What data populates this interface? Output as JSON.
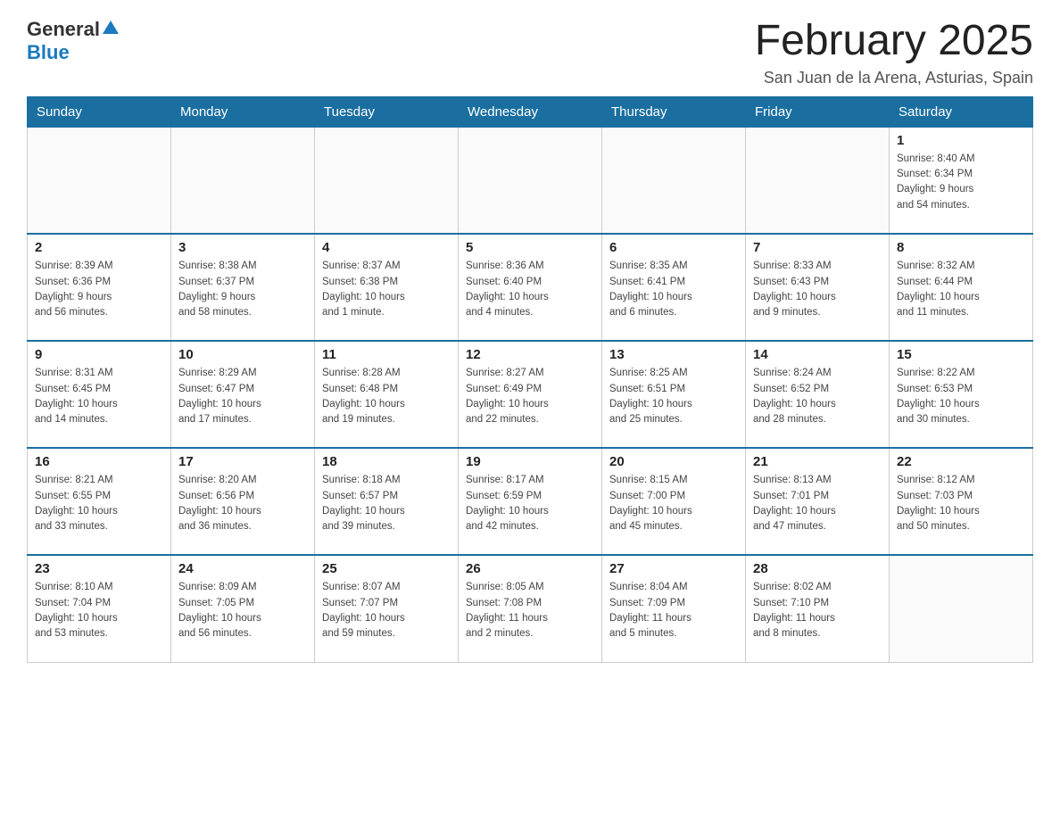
{
  "header": {
    "logo": {
      "general": "General",
      "blue": "Blue"
    },
    "title": "February 2025",
    "subtitle": "San Juan de la Arena, Asturias, Spain"
  },
  "days_of_week": [
    "Sunday",
    "Monday",
    "Tuesday",
    "Wednesday",
    "Thursday",
    "Friday",
    "Saturday"
  ],
  "weeks": [
    {
      "days": [
        {
          "num": "",
          "info": ""
        },
        {
          "num": "",
          "info": ""
        },
        {
          "num": "",
          "info": ""
        },
        {
          "num": "",
          "info": ""
        },
        {
          "num": "",
          "info": ""
        },
        {
          "num": "",
          "info": ""
        },
        {
          "num": "1",
          "info": "Sunrise: 8:40 AM\nSunset: 6:34 PM\nDaylight: 9 hours\nand 54 minutes."
        }
      ]
    },
    {
      "days": [
        {
          "num": "2",
          "info": "Sunrise: 8:39 AM\nSunset: 6:36 PM\nDaylight: 9 hours\nand 56 minutes."
        },
        {
          "num": "3",
          "info": "Sunrise: 8:38 AM\nSunset: 6:37 PM\nDaylight: 9 hours\nand 58 minutes."
        },
        {
          "num": "4",
          "info": "Sunrise: 8:37 AM\nSunset: 6:38 PM\nDaylight: 10 hours\nand 1 minute."
        },
        {
          "num": "5",
          "info": "Sunrise: 8:36 AM\nSunset: 6:40 PM\nDaylight: 10 hours\nand 4 minutes."
        },
        {
          "num": "6",
          "info": "Sunrise: 8:35 AM\nSunset: 6:41 PM\nDaylight: 10 hours\nand 6 minutes."
        },
        {
          "num": "7",
          "info": "Sunrise: 8:33 AM\nSunset: 6:43 PM\nDaylight: 10 hours\nand 9 minutes."
        },
        {
          "num": "8",
          "info": "Sunrise: 8:32 AM\nSunset: 6:44 PM\nDaylight: 10 hours\nand 11 minutes."
        }
      ]
    },
    {
      "days": [
        {
          "num": "9",
          "info": "Sunrise: 8:31 AM\nSunset: 6:45 PM\nDaylight: 10 hours\nand 14 minutes."
        },
        {
          "num": "10",
          "info": "Sunrise: 8:29 AM\nSunset: 6:47 PM\nDaylight: 10 hours\nand 17 minutes."
        },
        {
          "num": "11",
          "info": "Sunrise: 8:28 AM\nSunset: 6:48 PM\nDaylight: 10 hours\nand 19 minutes."
        },
        {
          "num": "12",
          "info": "Sunrise: 8:27 AM\nSunset: 6:49 PM\nDaylight: 10 hours\nand 22 minutes."
        },
        {
          "num": "13",
          "info": "Sunrise: 8:25 AM\nSunset: 6:51 PM\nDaylight: 10 hours\nand 25 minutes."
        },
        {
          "num": "14",
          "info": "Sunrise: 8:24 AM\nSunset: 6:52 PM\nDaylight: 10 hours\nand 28 minutes."
        },
        {
          "num": "15",
          "info": "Sunrise: 8:22 AM\nSunset: 6:53 PM\nDaylight: 10 hours\nand 30 minutes."
        }
      ]
    },
    {
      "days": [
        {
          "num": "16",
          "info": "Sunrise: 8:21 AM\nSunset: 6:55 PM\nDaylight: 10 hours\nand 33 minutes."
        },
        {
          "num": "17",
          "info": "Sunrise: 8:20 AM\nSunset: 6:56 PM\nDaylight: 10 hours\nand 36 minutes."
        },
        {
          "num": "18",
          "info": "Sunrise: 8:18 AM\nSunset: 6:57 PM\nDaylight: 10 hours\nand 39 minutes."
        },
        {
          "num": "19",
          "info": "Sunrise: 8:17 AM\nSunset: 6:59 PM\nDaylight: 10 hours\nand 42 minutes."
        },
        {
          "num": "20",
          "info": "Sunrise: 8:15 AM\nSunset: 7:00 PM\nDaylight: 10 hours\nand 45 minutes."
        },
        {
          "num": "21",
          "info": "Sunrise: 8:13 AM\nSunset: 7:01 PM\nDaylight: 10 hours\nand 47 minutes."
        },
        {
          "num": "22",
          "info": "Sunrise: 8:12 AM\nSunset: 7:03 PM\nDaylight: 10 hours\nand 50 minutes."
        }
      ]
    },
    {
      "days": [
        {
          "num": "23",
          "info": "Sunrise: 8:10 AM\nSunset: 7:04 PM\nDaylight: 10 hours\nand 53 minutes."
        },
        {
          "num": "24",
          "info": "Sunrise: 8:09 AM\nSunset: 7:05 PM\nDaylight: 10 hours\nand 56 minutes."
        },
        {
          "num": "25",
          "info": "Sunrise: 8:07 AM\nSunset: 7:07 PM\nDaylight: 10 hours\nand 59 minutes."
        },
        {
          "num": "26",
          "info": "Sunrise: 8:05 AM\nSunset: 7:08 PM\nDaylight: 11 hours\nand 2 minutes."
        },
        {
          "num": "27",
          "info": "Sunrise: 8:04 AM\nSunset: 7:09 PM\nDaylight: 11 hours\nand 5 minutes."
        },
        {
          "num": "28",
          "info": "Sunrise: 8:02 AM\nSunset: 7:10 PM\nDaylight: 11 hours\nand 8 minutes."
        },
        {
          "num": "",
          "info": ""
        }
      ]
    }
  ]
}
